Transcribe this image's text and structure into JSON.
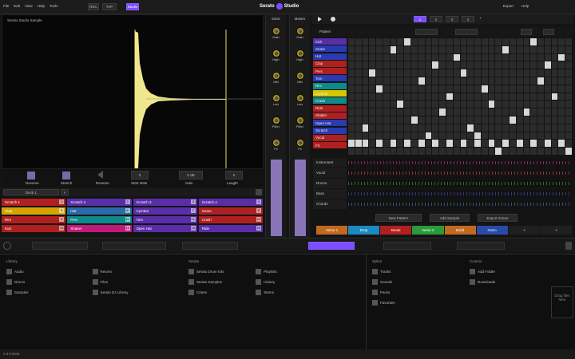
{
  "header": {
    "menu_items": [
      "File",
      "Edit",
      "View",
      "Help",
      "Tools"
    ],
    "tempo": "120",
    "left_buttons": [
      "REC",
      "TAP"
    ],
    "studio_btn": "Studio",
    "brand": "Serato",
    "product": "Studio",
    "right_buttons": [
      "Export",
      "Help"
    ]
  },
  "sample_panel": {
    "title": "Serato Studio Sample",
    "controls": [
      "Reverse",
      "Stretch",
      "Reverse",
      "Start Note",
      "Gain",
      "Length"
    ],
    "values": {
      "start": "0",
      "gain": "0 dB",
      "length": "0"
    },
    "deck_label": "Deck 1"
  },
  "pads": [
    {
      "label": "Scratch 1",
      "color": "#b02020",
      "num": "1"
    },
    {
      "label": "Scratch 2",
      "color": "#5a2ea8",
      "num": "2"
    },
    {
      "label": "Scratch 3",
      "color": "#5a2ea8",
      "num": "3"
    },
    {
      "label": "Scratch 4",
      "color": "#5a2ea8",
      "num": "4"
    },
    {
      "label": "Clap",
      "color": "#d6a300",
      "num": "5"
    },
    {
      "label": "Hat",
      "color": "#2a6aa8",
      "num": "6"
    },
    {
      "label": "Cymbal",
      "color": "#5a2ea8",
      "num": "7"
    },
    {
      "label": "Snare",
      "color": "#b02020",
      "num": "8"
    },
    {
      "label": "Rim",
      "color": "#b02020",
      "num": "9"
    },
    {
      "label": "Perc",
      "color": "#0e8a8a",
      "num": "10"
    },
    {
      "label": "Tom",
      "color": "#5a2ea8",
      "num": "11"
    },
    {
      "label": "Crash",
      "color": "#b02020",
      "num": "12"
    },
    {
      "label": "Kick",
      "color": "#b02020",
      "num": "13"
    },
    {
      "label": "Shaker",
      "color": "#c01a7a",
      "num": "14"
    },
    {
      "label": "Open Hat",
      "color": "#5a2ea8",
      "num": "15"
    },
    {
      "label": "Ride",
      "color": "#5a2ea8",
      "num": "16"
    }
  ],
  "mixer": {
    "ch1_label": "Deck",
    "ch2_label": "Master",
    "knob_labels": [
      "Gain",
      "High",
      "Mid",
      "Low",
      "Filter",
      "FX"
    ]
  },
  "sequencer": {
    "pattern_label": "Pattern",
    "tracks": [
      {
        "label": "Kick",
        "color": "#5a2ea8"
      },
      {
        "label": "Snare",
        "color": "#2a3ab0"
      },
      {
        "label": "Hat",
        "color": "#2a3ab0"
      },
      {
        "label": "Clap",
        "color": "#b02020"
      },
      {
        "label": "Perc",
        "color": "#b02020"
      },
      {
        "label": "Tom",
        "color": "#2a3ab0"
      },
      {
        "label": "Rim",
        "color": "#0e8a8a"
      },
      {
        "label": "Cymbal",
        "color": "#d6c600"
      },
      {
        "label": "Crash",
        "color": "#0e8a8a"
      },
      {
        "label": "Ride",
        "color": "#b02020"
      },
      {
        "label": "Shaker",
        "color": "#b02020"
      },
      {
        "label": "Open Hat",
        "color": "#2a3ab0"
      },
      {
        "label": "Scratch",
        "color": "#2a3ab0"
      },
      {
        "label": "Vocal",
        "color": "#b02020"
      },
      {
        "label": "FX",
        "color": "#b02020"
      }
    ],
    "instrument_tracks": [
      "Instrument",
      "Vocal",
      "Drums",
      "Bass",
      "Chords"
    ],
    "scenes": [
      {
        "label": "Verse 1",
        "color": "#c06a20"
      },
      {
        "label": "Drop",
        "color": "#1a8ac0"
      },
      {
        "label": "Break",
        "color": "#b02020"
      },
      {
        "label": "Verse 2",
        "color": "#2a9a3a"
      },
      {
        "label": "Build",
        "color": "#c06a20"
      },
      {
        "label": "Outro",
        "color": "#2a4aa8"
      },
      {
        "label": "+",
        "color": "#1f1f1f"
      },
      {
        "label": "+",
        "color": "#1f1f1f"
      }
    ],
    "buttons": [
      "New Pattern",
      "Add Sample",
      "Export Scene"
    ]
  },
  "browser": {
    "col1_title": "Library",
    "col1": [
      "Audio",
      "Drums",
      "Samples"
    ],
    "col1b": [
      "Recent",
      "Files",
      "Serato DJ Library"
    ],
    "col2_title": "Serato",
    "col2": [
      "Serato Drum Kits",
      "Serato Samples",
      "Crates"
    ],
    "col2b": [
      "Playlists",
      "History",
      "Stems"
    ],
    "col3_title": "Splice",
    "col3": [
      "Tracks",
      "Sounds",
      "Packs",
      "Favorites"
    ],
    "col4_title": "Custom",
    "col4": [
      "Add Folder",
      "Downloads"
    ],
    "side_label": "Drag files here"
  },
  "status": {
    "version": "2.3.0 Beta"
  }
}
